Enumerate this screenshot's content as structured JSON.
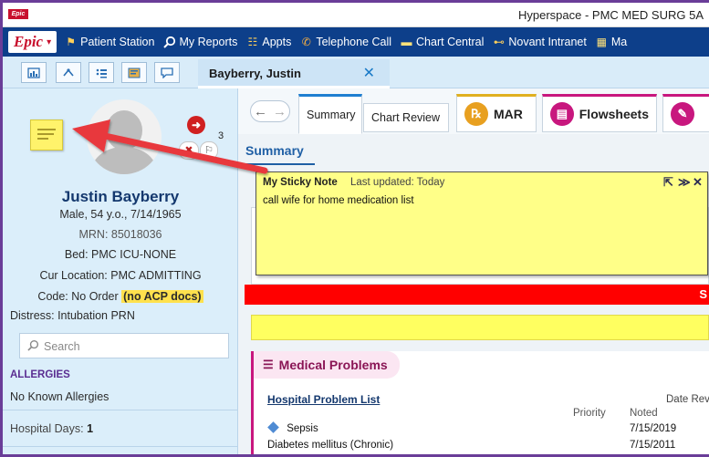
{
  "window": {
    "title": "Hyperspace - PMC MED SURG 5A",
    "app_badge": "Epic"
  },
  "toolbar": {
    "epic_label": "Epic",
    "items": [
      {
        "label": "Patient Station",
        "icon": "patient-station-icon"
      },
      {
        "label": "My Reports",
        "icon": "search-icon"
      },
      {
        "label": "Appts",
        "icon": "appointments-icon"
      },
      {
        "label": "Telephone Call",
        "icon": "telephone-icon"
      },
      {
        "label": "Chart Central",
        "icon": "chart-central-icon"
      },
      {
        "label": "Novant Intranet",
        "icon": "binoculars-icon"
      },
      {
        "label": "Ma",
        "icon": "calendar-icon"
      }
    ]
  },
  "patient_tab": {
    "name": "Bayberry, Justin",
    "close": "✕"
  },
  "storyboard": {
    "name": "Justin Bayberry",
    "demographics": "Male, 54 y.o., 7/14/1965",
    "mrn": "MRN: 85018036",
    "bed": "Bed: PMC ICU-NONE",
    "location": "Cur Location: PMC ADMITTING",
    "code_label": "Code: No Order",
    "acp": "(no ACP docs)",
    "distress": "Distress: Intubation PRN",
    "search_placeholder": "Search",
    "allergies_heading": "ALLERGIES",
    "allergies_value": "No Known Allergies",
    "hospital_days_label": "Hospital Days:",
    "hospital_days_value": "1",
    "flag_count": "3"
  },
  "activity_tabs": [
    {
      "label": "Summary",
      "accent": "#1f7fd1"
    },
    {
      "label": "Chart Review",
      "accent": "#c8d4df"
    },
    {
      "label": "MAR",
      "accent": "#e0b020"
    },
    {
      "label": "Flowsheets",
      "accent": "#c8177e"
    },
    {
      "label": "",
      "accent": "#c8177e"
    }
  ],
  "content": {
    "summary_title": "Summary",
    "red_bar_text": "S",
    "medical_problems_title": "Medical Problems",
    "hospital_problem_list": "Hospital Problem List",
    "col_date_reviewed": "Date Revie",
    "col_priority": "Priority",
    "col_noted": "Noted",
    "problems": [
      {
        "name": "Sepsis",
        "noted": "7/15/2019",
        "marker": true
      },
      {
        "name": "Diabetes mellitus (Chronic)",
        "noted": "7/15/2011",
        "marker": false
      }
    ]
  },
  "sticky_note": {
    "title": "My Sticky Note",
    "updated": "Last updated: Today",
    "text": "call wife for home medication list",
    "controls": {
      "pin": "⇱",
      "collapse": "≫",
      "close": "✕"
    }
  },
  "colors": {
    "toolbar_bg": "#0d3f8a",
    "brand_red": "#c8102e",
    "sticky_yellow": "#ffff88",
    "alert_red": "#ff0000",
    "annotation_arrow": "#e8383d"
  }
}
